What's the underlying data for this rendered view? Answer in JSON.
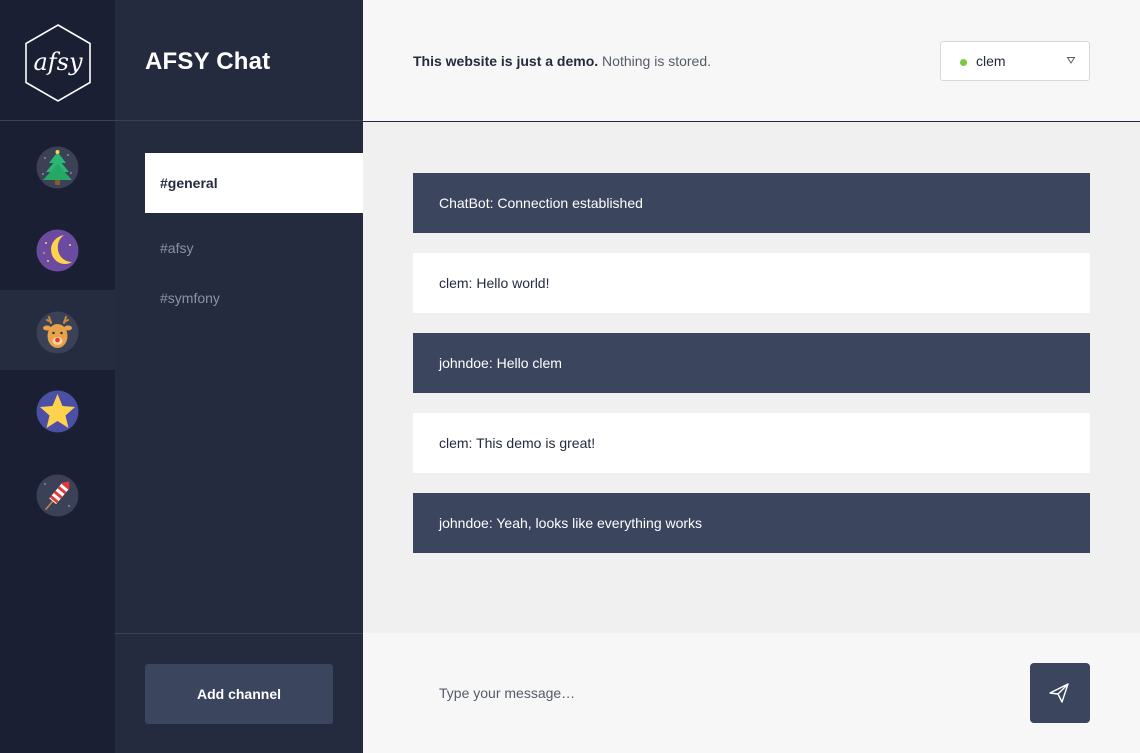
{
  "app": {
    "title": "AFSY Chat",
    "logo_text": "afsy"
  },
  "rail": {
    "items": [
      {
        "icon": "christmas-tree-icon",
        "active": false
      },
      {
        "icon": "moon-icon",
        "active": false
      },
      {
        "icon": "reindeer-icon",
        "active": true
      },
      {
        "icon": "star-icon",
        "active": false
      },
      {
        "icon": "firework-rocket-icon",
        "active": false
      }
    ]
  },
  "channels": {
    "items": [
      {
        "label": "#general",
        "active": true
      },
      {
        "label": "#afsy",
        "active": false
      },
      {
        "label": "#symfony",
        "active": false
      }
    ],
    "add_label": "Add channel"
  },
  "header": {
    "demo_bold": "This website is just a demo.",
    "demo_rest": " Nothing is stored.",
    "user": {
      "name": "clem",
      "status_color": "#7ac943"
    }
  },
  "messages": [
    {
      "text": "ChatBot: Connection established",
      "style": "dark"
    },
    {
      "text": "clem: Hello world!",
      "style": "light"
    },
    {
      "text": "johndoe: Hello clem",
      "style": "dark"
    },
    {
      "text": "clem: This demo is great!",
      "style": "light"
    },
    {
      "text": "johndoe: Yeah, looks like everything works",
      "style": "dark"
    }
  ],
  "composer": {
    "placeholder": "Type your message…"
  },
  "colors": {
    "rail_bg": "#1b1f33",
    "sidebar_bg": "#252b3e",
    "accent_dark": "#3b455e",
    "main_bg": "#f0f0f0",
    "online": "#7ac943"
  }
}
